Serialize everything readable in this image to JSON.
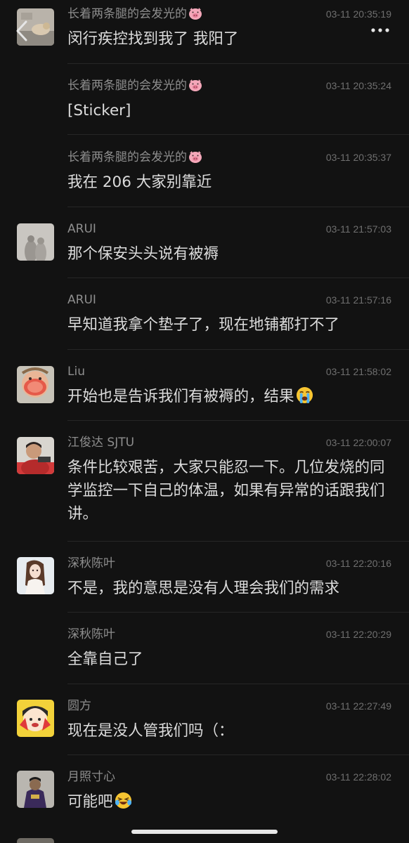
{
  "nav": {
    "back_icon": "chevron-left-icon",
    "more_icon": "more-dots-icon"
  },
  "messages": [
    {
      "sender": "长着两条腿的会发光的",
      "sender_emoji": "pig-icon",
      "time": "03-11 20:35:19",
      "text": "闵行疾控找到我了 我阳了",
      "avatar": "cat-photo"
    },
    {
      "sender": "长着两条腿的会发光的",
      "sender_emoji": "pig-icon",
      "time": "03-11 20:35:24",
      "text": "[Sticker]"
    },
    {
      "sender": "长着两条腿的会发光的",
      "sender_emoji": "pig-icon",
      "time": "03-11 20:35:37",
      "text": "我在 206 大家别靠近"
    },
    {
      "sender": "ARUI",
      "time": "03-11 21:57:03",
      "text": "那个保安头头说有被褥",
      "avatar": "shadow-photo"
    },
    {
      "sender": "ARUI",
      "time": "03-11 21:57:16",
      "text": "早知道我拿个垫子了，现在地铺都打不了"
    },
    {
      "sender": "Liu",
      "time": "03-11 21:58:02",
      "text": "开始也是告诉我们有被褥的，结果",
      "text_emoji": "loudly-crying-face-icon",
      "avatar": "child-photo"
    },
    {
      "sender": "江俊达 SJTU",
      "time": "03-11 22:00:07",
      "text": "条件比较艰苦，大家只能忍一下。几位发烧的同学监控一下自己的体温，如果有异常的话跟我们讲。",
      "avatar": "man-photo"
    },
    {
      "sender": "深秋陈叶",
      "time": "03-11 22:20:16",
      "text": "不是，我的意思是没有人理会我们的需求",
      "avatar": "anime-girl-photo"
    },
    {
      "sender": "深秋陈叶",
      "time": "03-11 22:20:29",
      "text": "全靠自己了"
    },
    {
      "sender": "圆方",
      "time": "03-11 22:27:49",
      "text": "现在是没人管我们吗（：",
      "avatar": "cartoon-girl-photo"
    },
    {
      "sender": "月照寸心",
      "time": "03-11 22:28:02",
      "text": "可能吧",
      "text_emoji": "laughing-crying-face-icon",
      "avatar": "hoodie-person-photo"
    }
  ]
}
